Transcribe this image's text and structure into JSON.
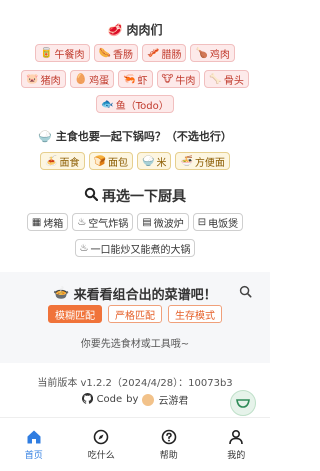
{
  "meat": {
    "title": "肉肉们",
    "title_icon": "meat-emoji",
    "row1": [
      {
        "label": "午餐肉",
        "icon": "luncheon-meat-icon",
        "glyph": "🥫"
      },
      {
        "label": "香肠",
        "icon": "sausage-icon",
        "glyph": "🌭"
      },
      {
        "label": "腊肠",
        "icon": "cured-sausage-icon",
        "glyph": "🥓"
      },
      {
        "label": "鸡肉",
        "icon": "chicken-icon",
        "glyph": "🍗"
      }
    ],
    "row2": [
      {
        "label": "猪肉",
        "icon": "pig-icon",
        "glyph": "🐷"
      },
      {
        "label": "鸡蛋",
        "icon": "egg-icon",
        "glyph": "🥚"
      },
      {
        "label": "虾",
        "icon": "shrimp-icon",
        "glyph": "🦐"
      },
      {
        "label": "牛肉",
        "icon": "cow-icon",
        "glyph": "🐮"
      },
      {
        "label": "骨头",
        "icon": "bone-icon",
        "glyph": "🦴"
      }
    ],
    "row3": [
      {
        "label": "鱼（Todo）",
        "icon": "fish-icon",
        "glyph": "🐟"
      }
    ]
  },
  "staple": {
    "title": "主食也要一起下锅吗？（不选也行）",
    "title_icon": "rice-bowl-emoji",
    "items": [
      {
        "label": "面食",
        "icon": "noodles-icon",
        "glyph": "🍝"
      },
      {
        "label": "面包",
        "icon": "bread-icon",
        "glyph": "🍞"
      },
      {
        "label": "米",
        "icon": "rice-icon",
        "glyph": "🍚"
      },
      {
        "label": "方便面",
        "icon": "instant-noodle-icon",
        "glyph": "🍜"
      }
    ]
  },
  "tools": {
    "title": "再选一下厨具",
    "title_icon": "magnifier-icon",
    "row1": [
      {
        "label": "烤箱",
        "icon": "oven-icon",
        "glyph": "▦"
      },
      {
        "label": "空气炸锅",
        "icon": "air-fryer-icon",
        "glyph": "♨"
      },
      {
        "label": "微波炉",
        "icon": "microwave-icon",
        "glyph": "▤"
      },
      {
        "label": "电饭煲",
        "icon": "rice-cooker-icon",
        "glyph": "⊟"
      }
    ],
    "row2": [
      {
        "label": "一口能炒又能煮的大锅",
        "icon": "pot-icon",
        "glyph": "♨"
      }
    ]
  },
  "recipe": {
    "title": "来看看组合出的菜谱吧！",
    "title_icon": "plate-emoji",
    "modes": [
      {
        "label": "模糊匹配",
        "active": true
      },
      {
        "label": "严格匹配",
        "active": false
      },
      {
        "label": "生存模式",
        "active": false
      }
    ],
    "hint": "你要先选食材或工具哦~"
  },
  "footer": {
    "version": "当前版本 v1.2.2（2024/4/28）：10073b3",
    "code_label": "Code",
    "by": "by",
    "author": "云游君"
  },
  "tabbar": [
    {
      "label": "首页",
      "icon": "home-icon",
      "active": true
    },
    {
      "label": "吃什么",
      "icon": "compass-icon",
      "active": false
    },
    {
      "label": "帮助",
      "icon": "help-icon",
      "active": false
    },
    {
      "label": "我的",
      "icon": "user-icon",
      "active": false
    }
  ],
  "colors": {
    "accent": "#2f7de1",
    "meat_bg": "#fdeaea",
    "staple_bg": "#fdf6e1",
    "mode_active": "#f0733a"
  }
}
